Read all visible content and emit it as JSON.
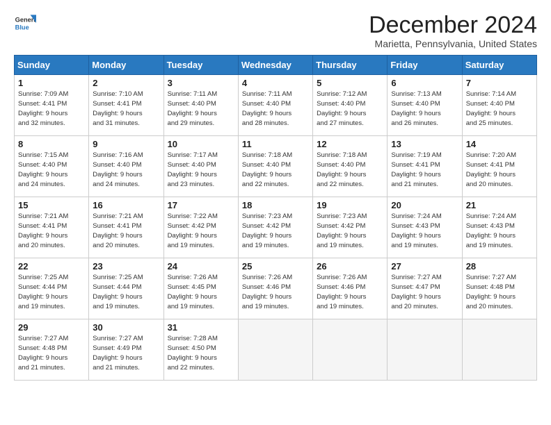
{
  "header": {
    "logo_line1": "General",
    "logo_line2": "Blue",
    "month_title": "December 2024",
    "subtitle": "Marietta, Pennsylvania, United States"
  },
  "days_of_week": [
    "Sunday",
    "Monday",
    "Tuesday",
    "Wednesday",
    "Thursday",
    "Friday",
    "Saturday"
  ],
  "weeks": [
    [
      {
        "num": "1",
        "info": "Sunrise: 7:09 AM\nSunset: 4:41 PM\nDaylight: 9 hours\nand 32 minutes."
      },
      {
        "num": "2",
        "info": "Sunrise: 7:10 AM\nSunset: 4:41 PM\nDaylight: 9 hours\nand 31 minutes."
      },
      {
        "num": "3",
        "info": "Sunrise: 7:11 AM\nSunset: 4:40 PM\nDaylight: 9 hours\nand 29 minutes."
      },
      {
        "num": "4",
        "info": "Sunrise: 7:11 AM\nSunset: 4:40 PM\nDaylight: 9 hours\nand 28 minutes."
      },
      {
        "num": "5",
        "info": "Sunrise: 7:12 AM\nSunset: 4:40 PM\nDaylight: 9 hours\nand 27 minutes."
      },
      {
        "num": "6",
        "info": "Sunrise: 7:13 AM\nSunset: 4:40 PM\nDaylight: 9 hours\nand 26 minutes."
      },
      {
        "num": "7",
        "info": "Sunrise: 7:14 AM\nSunset: 4:40 PM\nDaylight: 9 hours\nand 25 minutes."
      }
    ],
    [
      {
        "num": "8",
        "info": "Sunrise: 7:15 AM\nSunset: 4:40 PM\nDaylight: 9 hours\nand 24 minutes."
      },
      {
        "num": "9",
        "info": "Sunrise: 7:16 AM\nSunset: 4:40 PM\nDaylight: 9 hours\nand 24 minutes."
      },
      {
        "num": "10",
        "info": "Sunrise: 7:17 AM\nSunset: 4:40 PM\nDaylight: 9 hours\nand 23 minutes."
      },
      {
        "num": "11",
        "info": "Sunrise: 7:18 AM\nSunset: 4:40 PM\nDaylight: 9 hours\nand 22 minutes."
      },
      {
        "num": "12",
        "info": "Sunrise: 7:18 AM\nSunset: 4:40 PM\nDaylight: 9 hours\nand 22 minutes."
      },
      {
        "num": "13",
        "info": "Sunrise: 7:19 AM\nSunset: 4:41 PM\nDaylight: 9 hours\nand 21 minutes."
      },
      {
        "num": "14",
        "info": "Sunrise: 7:20 AM\nSunset: 4:41 PM\nDaylight: 9 hours\nand 20 minutes."
      }
    ],
    [
      {
        "num": "15",
        "info": "Sunrise: 7:21 AM\nSunset: 4:41 PM\nDaylight: 9 hours\nand 20 minutes."
      },
      {
        "num": "16",
        "info": "Sunrise: 7:21 AM\nSunset: 4:41 PM\nDaylight: 9 hours\nand 20 minutes."
      },
      {
        "num": "17",
        "info": "Sunrise: 7:22 AM\nSunset: 4:42 PM\nDaylight: 9 hours\nand 19 minutes."
      },
      {
        "num": "18",
        "info": "Sunrise: 7:23 AM\nSunset: 4:42 PM\nDaylight: 9 hours\nand 19 minutes."
      },
      {
        "num": "19",
        "info": "Sunrise: 7:23 AM\nSunset: 4:42 PM\nDaylight: 9 hours\nand 19 minutes."
      },
      {
        "num": "20",
        "info": "Sunrise: 7:24 AM\nSunset: 4:43 PM\nDaylight: 9 hours\nand 19 minutes."
      },
      {
        "num": "21",
        "info": "Sunrise: 7:24 AM\nSunset: 4:43 PM\nDaylight: 9 hours\nand 19 minutes."
      }
    ],
    [
      {
        "num": "22",
        "info": "Sunrise: 7:25 AM\nSunset: 4:44 PM\nDaylight: 9 hours\nand 19 minutes."
      },
      {
        "num": "23",
        "info": "Sunrise: 7:25 AM\nSunset: 4:44 PM\nDaylight: 9 hours\nand 19 minutes."
      },
      {
        "num": "24",
        "info": "Sunrise: 7:26 AM\nSunset: 4:45 PM\nDaylight: 9 hours\nand 19 minutes."
      },
      {
        "num": "25",
        "info": "Sunrise: 7:26 AM\nSunset: 4:46 PM\nDaylight: 9 hours\nand 19 minutes."
      },
      {
        "num": "26",
        "info": "Sunrise: 7:26 AM\nSunset: 4:46 PM\nDaylight: 9 hours\nand 19 minutes."
      },
      {
        "num": "27",
        "info": "Sunrise: 7:27 AM\nSunset: 4:47 PM\nDaylight: 9 hours\nand 20 minutes."
      },
      {
        "num": "28",
        "info": "Sunrise: 7:27 AM\nSunset: 4:48 PM\nDaylight: 9 hours\nand 20 minutes."
      }
    ],
    [
      {
        "num": "29",
        "info": "Sunrise: 7:27 AM\nSunset: 4:48 PM\nDaylight: 9 hours\nand 21 minutes."
      },
      {
        "num": "30",
        "info": "Sunrise: 7:27 AM\nSunset: 4:49 PM\nDaylight: 9 hours\nand 21 minutes."
      },
      {
        "num": "31",
        "info": "Sunrise: 7:28 AM\nSunset: 4:50 PM\nDaylight: 9 hours\nand 22 minutes."
      },
      null,
      null,
      null,
      null
    ]
  ]
}
